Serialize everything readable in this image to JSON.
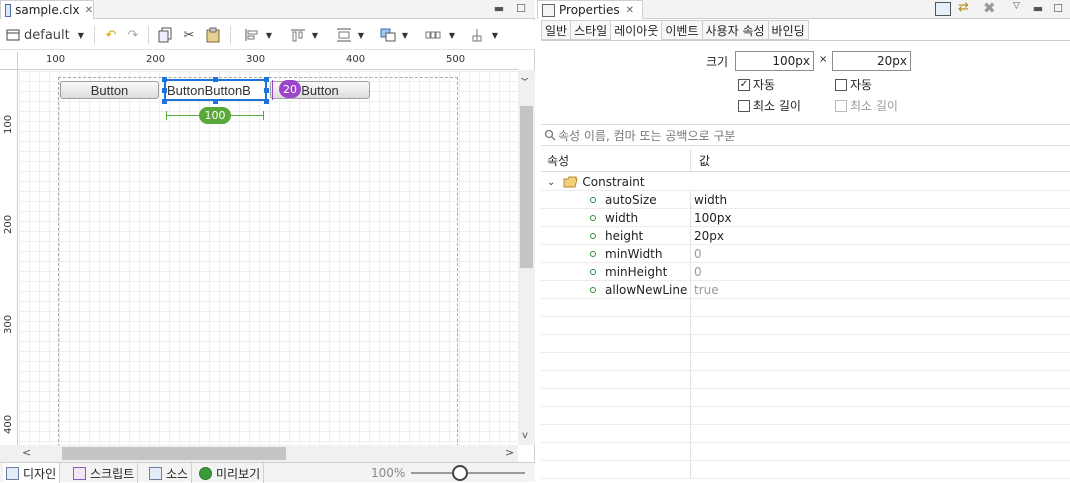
{
  "editor": {
    "tab_title": "sample.clx",
    "tab_close": "✕",
    "win_min": "▬",
    "win_max": "☐",
    "toolbar": {
      "default_label": "default",
      "caret": "▼"
    },
    "ruler_h": [
      "100",
      "200",
      "300",
      "400",
      "500"
    ],
    "ruler_v": [
      "100",
      "200",
      "300",
      "400"
    ],
    "buttons": {
      "left": "Button",
      "selected": "ButtonButtonB",
      "right": "Button"
    },
    "width_badge": "100",
    "height_badge": "20",
    "scroll_left": "<",
    "scroll_right": ">",
    "scroll_up": "^",
    "scroll_down": "v",
    "bottom_tabs": [
      "디자인",
      "스크립트",
      "소스",
      "미리보기"
    ],
    "zoom": "100%"
  },
  "properties": {
    "tab_title": "Properties",
    "tab_close": "✕",
    "sub_tabs": [
      "일반",
      "스타일",
      "레이아웃",
      "이벤트",
      "사용자 속성",
      "바인딩"
    ],
    "active_sub_tab": "레이아웃",
    "size_label": "크기",
    "width_value": "100px",
    "times": "×",
    "height_value": "20px",
    "check_auto_w": "자동",
    "check_auto_h": "자동",
    "check_min_w": "최소 길이",
    "check_min_h": "최소 길이",
    "search_placeholder": "속성 이름, 컴마 또는 공백으로 구분",
    "col_prop": "속성",
    "col_value": "값",
    "group": "Constraint",
    "rows": [
      {
        "key": "autoSize",
        "value": "width"
      },
      {
        "key": "width",
        "value": "100px"
      },
      {
        "key": "height",
        "value": "20px"
      },
      {
        "key": "minWidth",
        "value": "0"
      },
      {
        "key": "minHeight",
        "value": "0"
      },
      {
        "key": "allowNewLine",
        "value": "true"
      }
    ]
  },
  "colors": {
    "selection": "#1e73d8",
    "width_badge": "#5aa83a",
    "height_badge": "#9b45c9"
  }
}
